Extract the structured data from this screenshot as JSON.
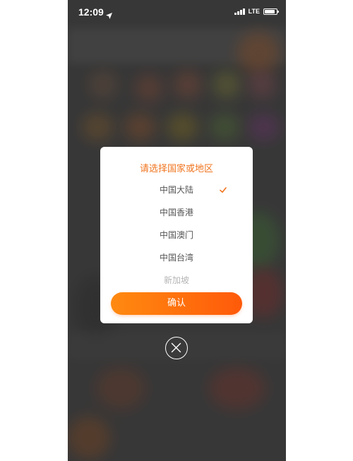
{
  "status_bar": {
    "time": "12:09",
    "network": "LTE",
    "icons": [
      "location-arrow-icon",
      "signal-icon",
      "battery-icon"
    ],
    "battery_level": 0.85
  },
  "dialog": {
    "title": "请选择国家或地区",
    "options": [
      {
        "label": "中国大陆",
        "selected": true
      },
      {
        "label": "中国香港",
        "selected": false
      },
      {
        "label": "中国澳门",
        "selected": false
      },
      {
        "label": "中国台湾",
        "selected": false
      },
      {
        "label": "新加坡",
        "selected": false
      }
    ],
    "confirm_label": "确认",
    "close_icon": "close-icon"
  },
  "colors": {
    "accent": "#f0741e",
    "button_start": "#ff8a10",
    "button_end": "#ff5a0a",
    "overlay": "#4a4a4a"
  }
}
